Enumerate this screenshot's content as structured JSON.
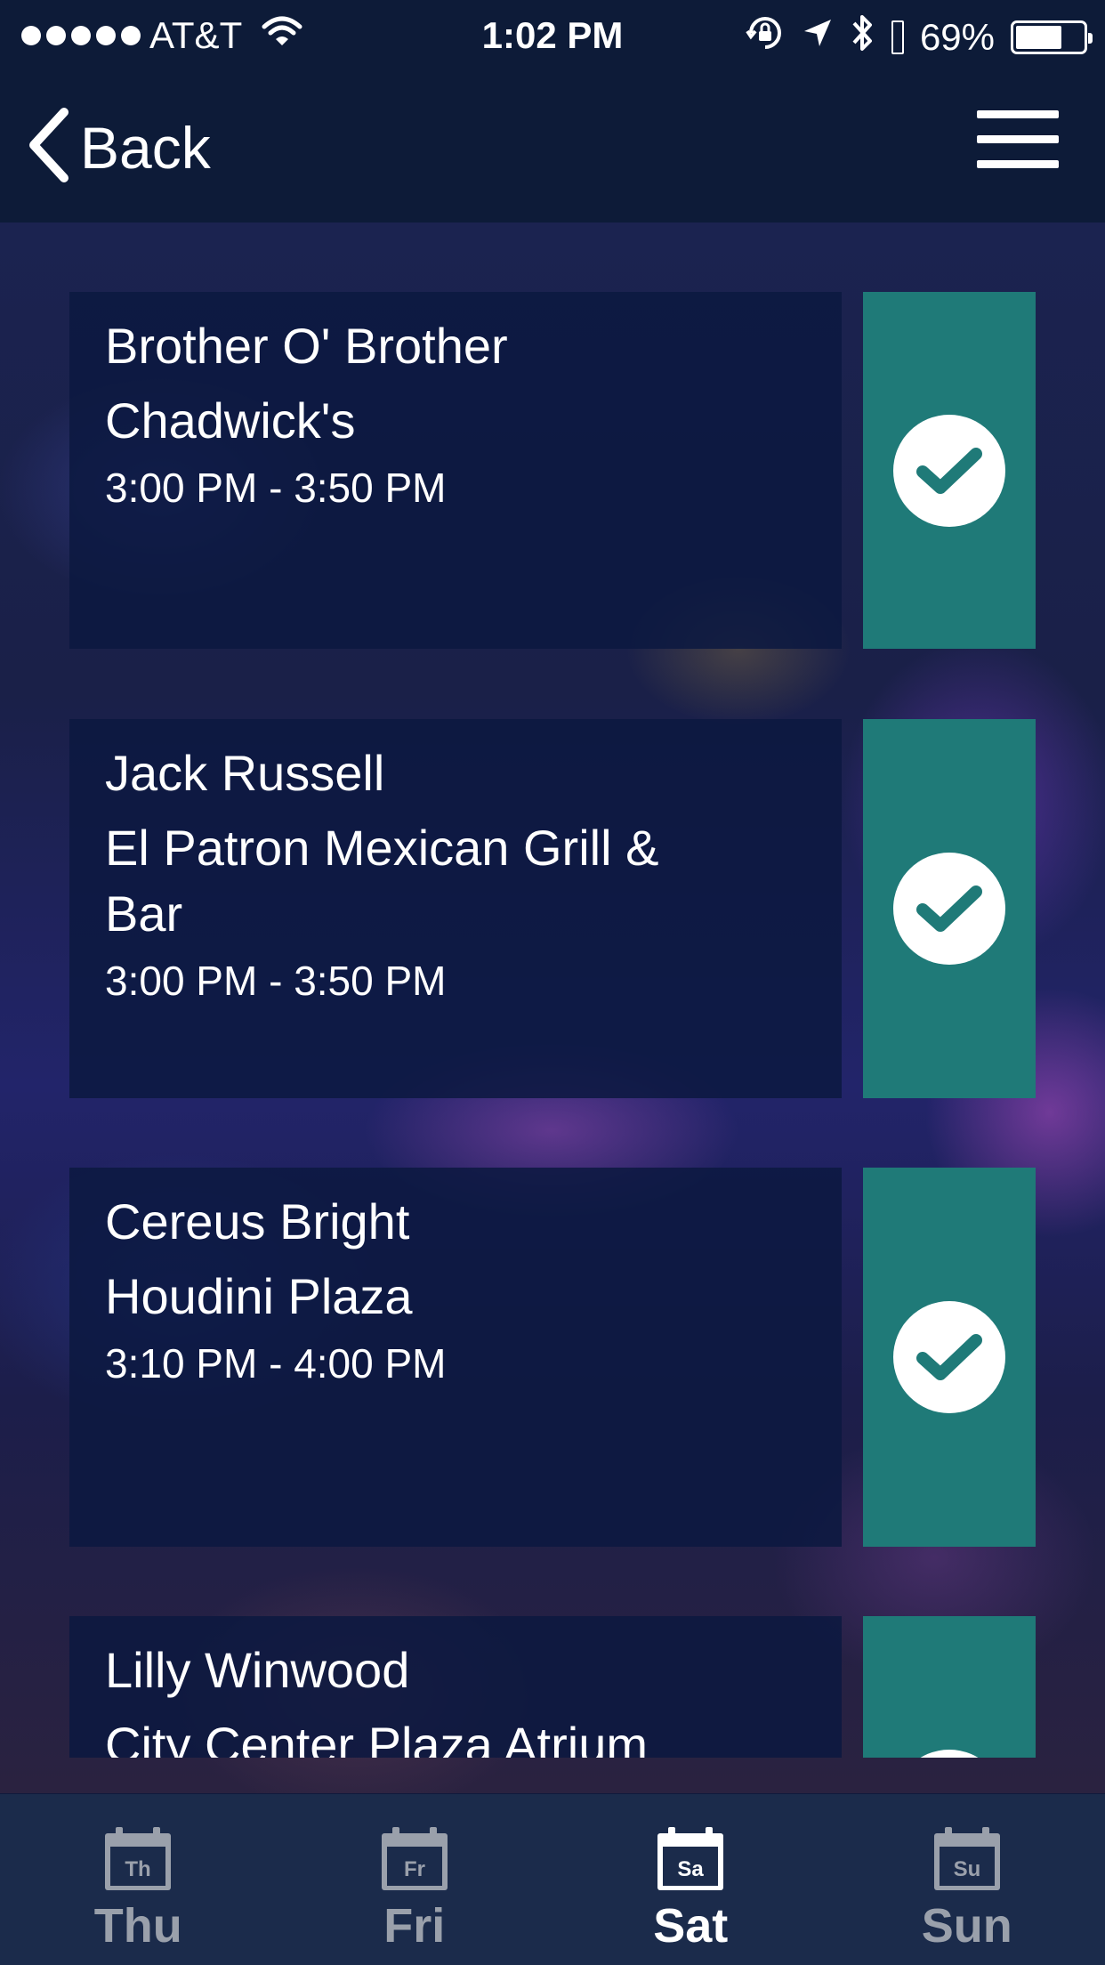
{
  "status_bar": {
    "carrier": "AT&T",
    "time": "1:02 PM",
    "battery_percent": "69%",
    "battery_level": 0.69
  },
  "nav": {
    "back_label": "Back"
  },
  "events": [
    {
      "artist": "Brother O' Brother",
      "venue": "Chadwick's",
      "time": "3:00 PM - 3:50 PM"
    },
    {
      "artist": "Jack Russell",
      "venue": "El Patron Mexican Grill & Bar",
      "time": "3:00 PM - 3:50 PM"
    },
    {
      "artist": "Cereus Bright",
      "venue": "Houdini Plaza",
      "time": "3:10 PM - 4:00 PM"
    },
    {
      "artist": "Lilly Winwood",
      "venue": "City Center Plaza Atrium",
      "time": ""
    }
  ],
  "tabs": [
    {
      "label": "Thu",
      "icon_text": "Th",
      "active": false
    },
    {
      "label": "Fri",
      "icon_text": "Fr",
      "active": false
    },
    {
      "label": "Sat",
      "icon_text": "Sa",
      "active": true
    },
    {
      "label": "Sun",
      "icon_text": "Su",
      "active": false
    }
  ],
  "colors": {
    "header": "#0d1b38",
    "card": "#0c1840",
    "check_column": "#1f7a78",
    "tab_bar": "#1b2b4b",
    "tab_inactive": "#9aa0ab",
    "tab_active": "#ffffff"
  }
}
